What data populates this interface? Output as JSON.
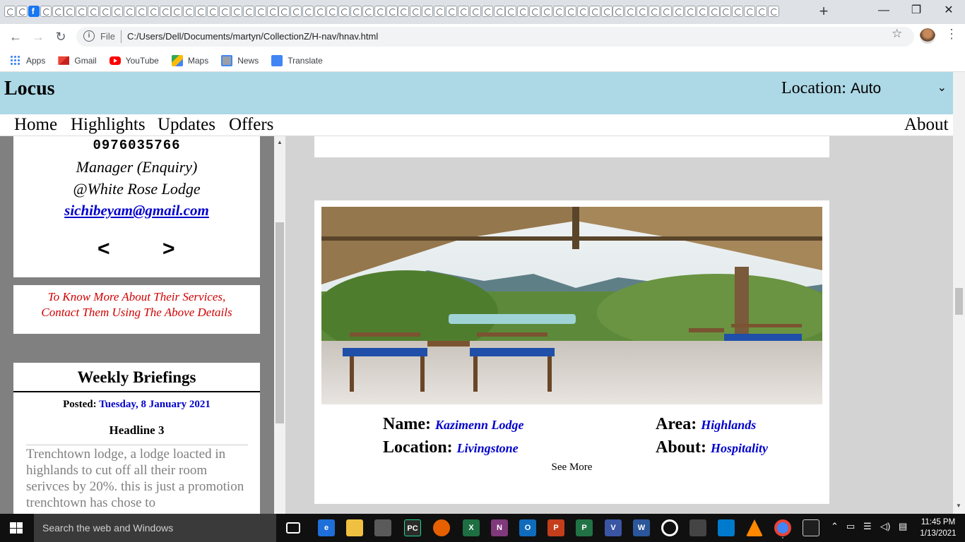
{
  "browser": {
    "new_tab": "+",
    "window_controls": {
      "minimize": "—",
      "maximize": "❐",
      "close": "✕"
    },
    "nav": {
      "back": "←",
      "forward": "→",
      "reload": "↻"
    },
    "omnibox": {
      "scheme_label": "File",
      "url": "C:/Users/Dell/Documents/martyn/CollectionZ/H-nav/hnav.html"
    },
    "bookmarks": [
      {
        "label": "Apps",
        "icon": "apps-icon"
      },
      {
        "label": "Gmail",
        "icon": "gmail-icon"
      },
      {
        "label": "YouTube",
        "icon": "youtube-icon"
      },
      {
        "label": "Maps",
        "icon": "maps-icon"
      },
      {
        "label": "News",
        "icon": "news-icon"
      },
      {
        "label": "Translate",
        "icon": "translate-icon"
      }
    ]
  },
  "site": {
    "logo": "Locus",
    "location_label": "Location:",
    "location_value": "Auto",
    "nav": [
      "Home",
      "Highlights",
      "Updates",
      "Offers"
    ],
    "nav_right": "About"
  },
  "contact_card": {
    "phone": "0976035766",
    "role": "Manager (Enquiry)",
    "lodge": "@White Rose Lodge",
    "email": "sichibeyam@gmail.com",
    "prev": "<",
    "next": ">"
  },
  "notice": {
    "line1": "To Know More About Their Services,",
    "line2": "Contact Them Using The Above Details"
  },
  "briefings": {
    "title": "Weekly Briefings",
    "posted_label": "Posted:",
    "posted_date": "Tuesday, 8 January 2021",
    "headline": "Headline 3",
    "story": "Trenchtown lodge, a lodge loacted in highlands to cut off all their room serivces by 20%. this is just a promotion trenchtown has chose to"
  },
  "listing": {
    "name_label": "Name:",
    "name_value": "Kazimenn Lodge",
    "location_label": "Location:",
    "location_value": "Livingstone",
    "area_label": "Area:",
    "area_value": "Highlands",
    "about_label": "About:",
    "about_value": "Hospitality",
    "see_more": "See More"
  },
  "taskbar": {
    "search_placeholder": "Search the web and Windows",
    "time": "11:45 PM",
    "date": "1/13/2021"
  },
  "colors": {
    "header_bg": "#add8e6",
    "left_panel_bg": "#808080",
    "right_panel_bg": "#d3d3d3",
    "link_blue": "#0000cd",
    "notice_red": "#d00000"
  }
}
